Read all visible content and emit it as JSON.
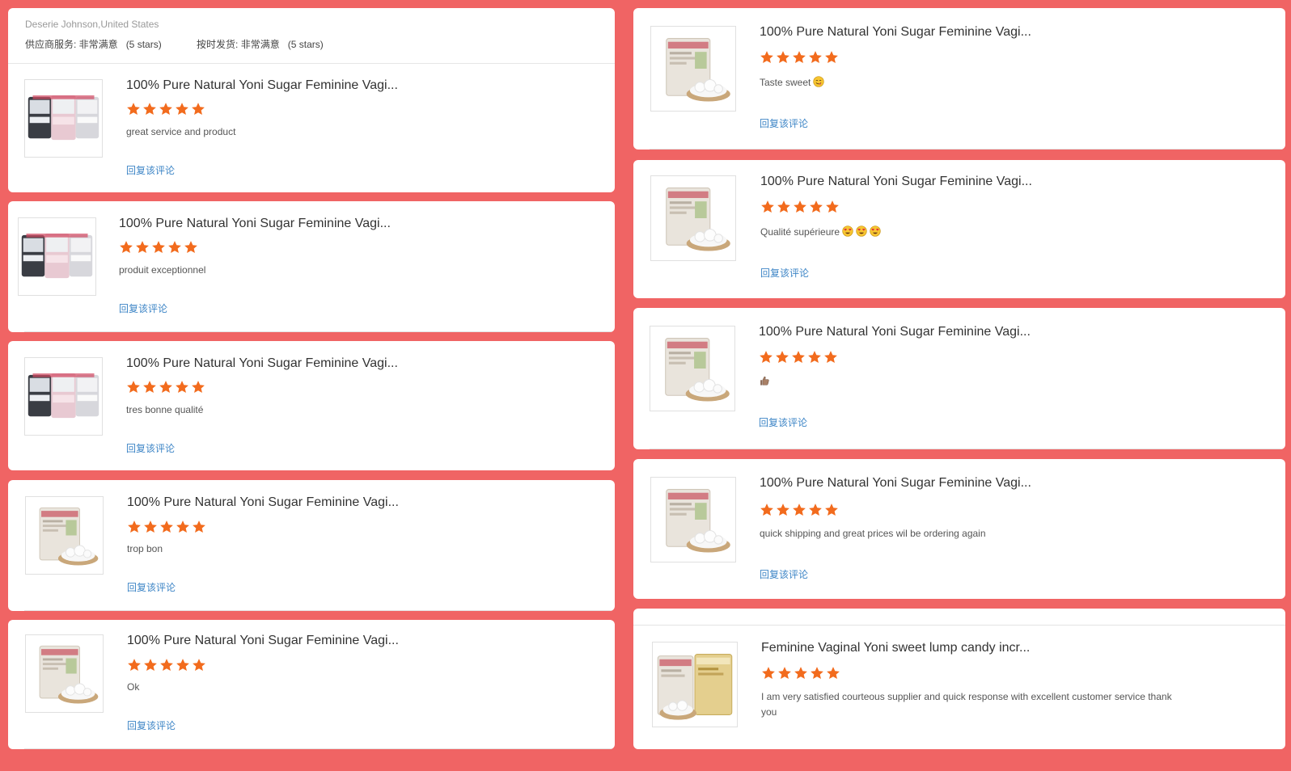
{
  "buyer": {
    "name_country": "Deserie Johnson,United States",
    "supplier_service": "供应商服务: 非常满意",
    "supplier_service_stars": "(5 stars)",
    "ontime_shipping": "按时发货: 非常满意",
    "ontime_shipping_stars": "(5 stars)"
  },
  "reply_label": "回复该评论",
  "star_color": "#f26b1d",
  "left_reviews": [
    {
      "title": "100% Pure Natural Yoni Sugar Feminine Vagi...",
      "rating": 5,
      "comment": "great service and product",
      "image": "three-pouches-icon"
    },
    {
      "title": "100% Pure Natural Yoni Sugar Feminine Vagi...",
      "rating": 5,
      "comment": "produit exceptionnel",
      "image": "three-pouches-icon"
    },
    {
      "title": "100% Pure Natural Yoni Sugar Feminine Vagi...",
      "rating": 5,
      "comment": "tres bonne qualité",
      "image": "three-pouches-icon"
    },
    {
      "title": "100% Pure Natural Yoni Sugar Feminine Vagi...",
      "rating": 5,
      "comment": "trop bon",
      "image": "pouch-with-bowl-icon"
    },
    {
      "title": "100% Pure Natural Yoni Sugar Feminine Vagi...",
      "rating": 5,
      "comment": "Ok",
      "image": "pouch-with-bowl-icon"
    }
  ],
  "right_reviews": [
    {
      "title": "100% Pure Natural Yoni Sugar Feminine Vagi...",
      "rating": 5,
      "comment": "Taste sweet",
      "emoji": [
        "yum-face-emoji"
      ],
      "image": "pouch-with-bowl-icon"
    },
    {
      "title": "100% Pure Natural Yoni Sugar Feminine Vagi...",
      "rating": 5,
      "comment": "Qualité supérieure",
      "emoji": [
        "heart-eyes-emoji",
        "heart-eyes-emoji",
        "heart-eyes-emoji"
      ],
      "image": "pouch-with-bowl-icon"
    },
    {
      "title": "100% Pure Natural Yoni Sugar Feminine Vagi...",
      "rating": 5,
      "comment": "",
      "emoji": [
        "thumbs-up-emoji"
      ],
      "image": "pouch-with-bowl-icon"
    },
    {
      "title": "100% Pure Natural Yoni Sugar Feminine Vagi...",
      "rating": 5,
      "comment": "quick shipping and great prices wil be ordering again",
      "emoji": [],
      "image": "pouch-with-bowl-icon"
    },
    {
      "title": "Feminine Vaginal Yoni sweet lump candy incr...",
      "rating": 5,
      "comment": "I am very satisfied courteous supplier and quick response with excellent customer service thank you",
      "emoji": [],
      "image": "two-pouches-gold-icon"
    }
  ]
}
